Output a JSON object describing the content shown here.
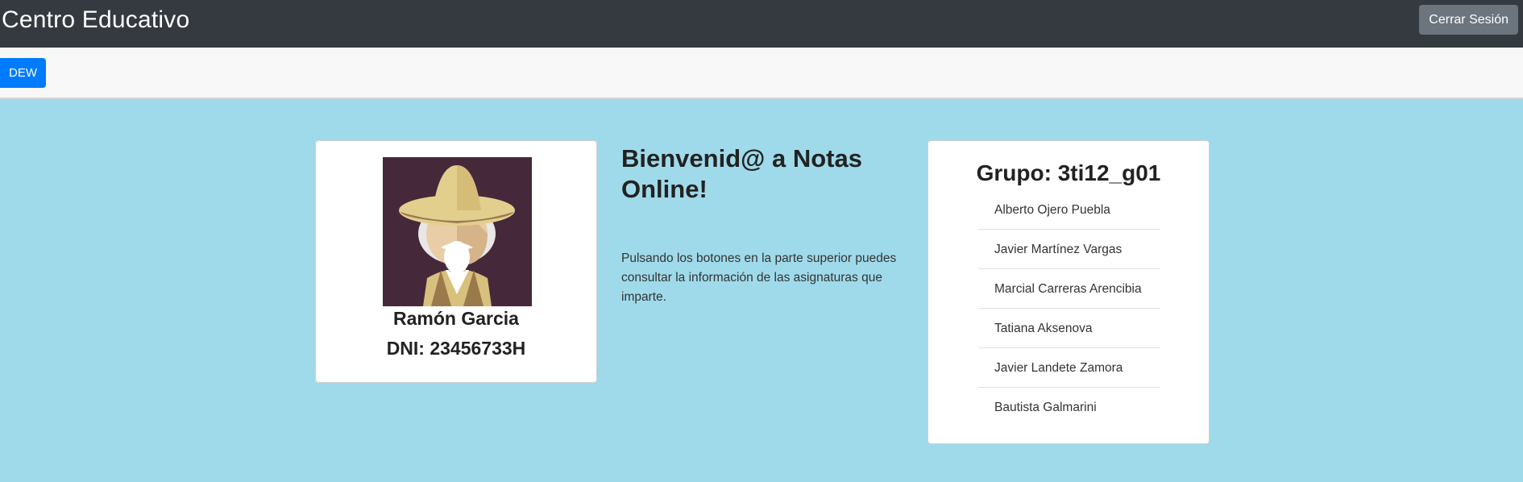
{
  "header": {
    "brand": "Centro Educativo",
    "logout_label": "Cerrar Sesión"
  },
  "toolbar": {
    "subject_button": "DEW"
  },
  "profile": {
    "name": "Ramón Garcia",
    "dni": "DNI: 23456733H",
    "avatar_icon": "sombrero-man-avatar"
  },
  "welcome": {
    "title": "Bienvenid@ a Notas Online!",
    "text": "Pulsando los botones en la parte superior puedes consultar la información de las asignaturas que imparte."
  },
  "group": {
    "title": "Grupo: 3ti12_g01",
    "members": [
      "Alberto Ojero Puebla",
      "Javier Martínez Vargas",
      "Marcial Carreras Arencibia",
      "Tatiana Aksenova",
      "Javier Landete Zamora",
      "Bautista Galmarini"
    ]
  },
  "colors": {
    "navbar": "#343a40",
    "background": "#9fdaea",
    "primary": "#007bff",
    "secondary": "#6c757d"
  }
}
